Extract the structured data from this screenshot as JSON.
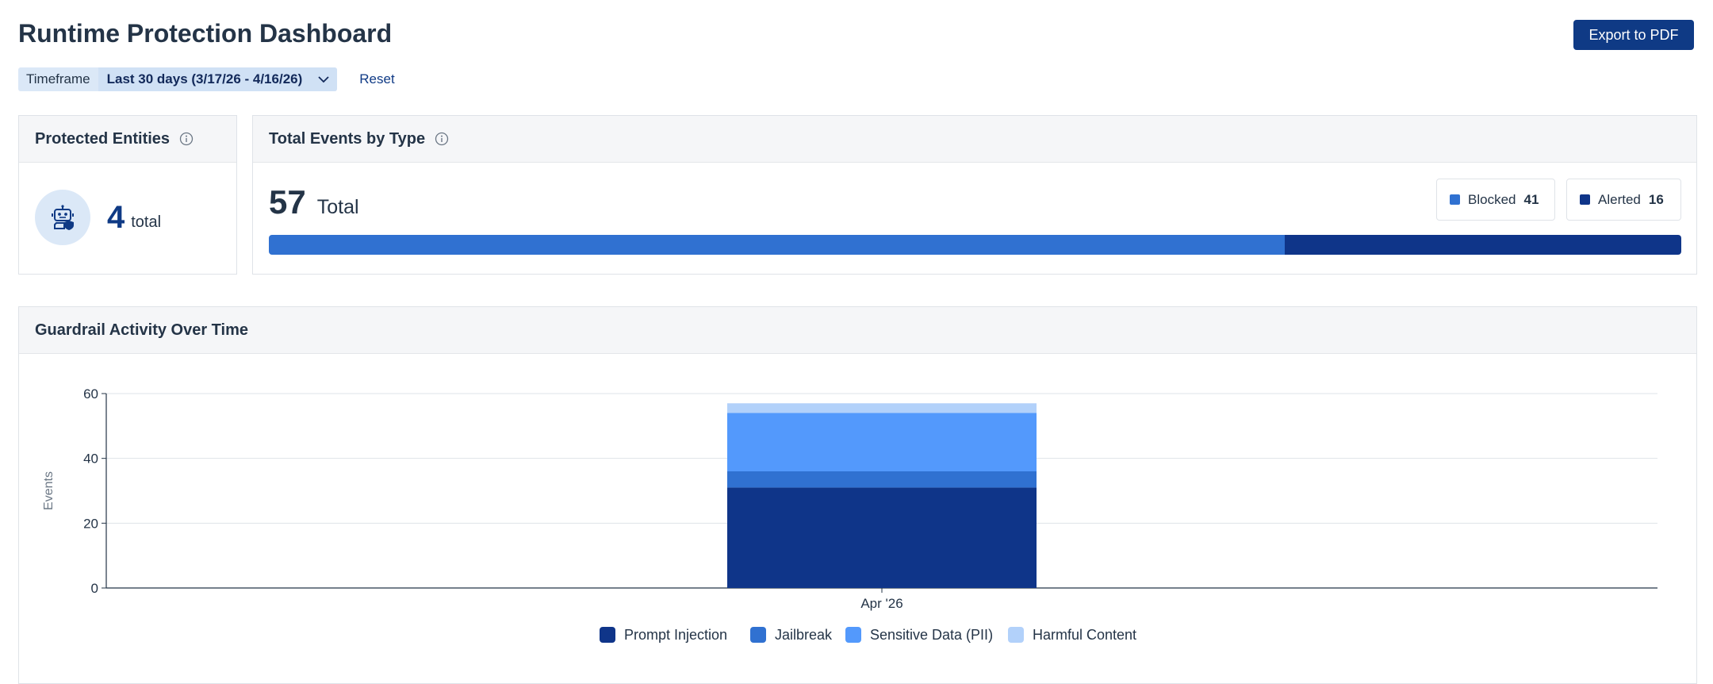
{
  "header": {
    "title": "Runtime Protection Dashboard",
    "export_label": "Export to PDF"
  },
  "filters": {
    "timeframe_label": "Timeframe",
    "timeframe_value": "Last 30 days (3/17/26 - 4/16/26)",
    "reset_label": "Reset"
  },
  "entities_card": {
    "title": "Protected Entities",
    "count": "4",
    "unit": "total"
  },
  "events_card": {
    "title": "Total Events by Type",
    "total": "57",
    "total_label": "Total",
    "blocked_label": "Blocked",
    "blocked_count": 41,
    "alerted_label": "Alerted",
    "alerted_count": 16
  },
  "activity_card": {
    "title": "Guardrail Activity Over Time"
  },
  "colors": {
    "brand": "#0f3a85",
    "prompt_injection": "#0f3589",
    "jailbreak": "#3071d1",
    "sensitive_data": "#5399fc",
    "harmful_content": "#b2d1fa",
    "blocked": "#3071d1",
    "alerted": "#0f3589"
  },
  "chart_data": {
    "type": "bar",
    "stacked": true,
    "categories": [
      "Apr '26"
    ],
    "series": [
      {
        "name": "Prompt Injection",
        "values": [
          31
        ]
      },
      {
        "name": "Jailbreak",
        "values": [
          5
        ]
      },
      {
        "name": "Sensitive Data (PII)",
        "values": [
          18
        ]
      },
      {
        "name": "Harmful Content",
        "values": [
          3
        ]
      }
    ],
    "xlabel": "",
    "ylabel": "Events",
    "ylim": [
      0,
      60
    ],
    "yticks": [
      0,
      20,
      40,
      60
    ],
    "grid": true,
    "legend": "bottom-center"
  }
}
